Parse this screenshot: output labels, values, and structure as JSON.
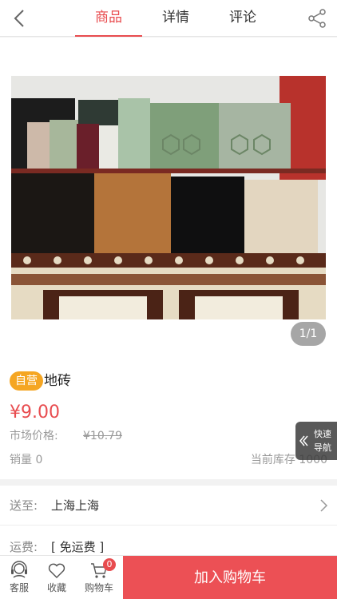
{
  "header": {
    "tabs": [
      {
        "label": "商品",
        "active": true
      },
      {
        "label": "详情",
        "active": false
      },
      {
        "label": "评论",
        "active": false
      }
    ],
    "back_icon": "chevron-left-icon",
    "share_icon": "share-icon"
  },
  "gallery": {
    "counter": "1/1"
  },
  "product": {
    "badge": "自营",
    "title": "地砖",
    "price": "¥9.00",
    "market_price_label": "市场价格:",
    "market_price": "¥10.79",
    "sales": "销量 0",
    "stock": "当前库存 1000"
  },
  "quick_nav": {
    "label": "快速导航"
  },
  "shipping": {
    "deliver_label": "送至:",
    "deliver_value": "上海上海",
    "fee_label": "运费:",
    "fee_value": "[ 免运费 ]"
  },
  "bottom_bar": {
    "service": "客服",
    "favorite": "收藏",
    "cart": "购物车",
    "cart_count": "0",
    "add_to_cart": "加入购物车"
  },
  "colors": {
    "accent": "#e84c4f",
    "badge": "#f5a623",
    "add_to_cart_bg": "#ec5055"
  }
}
